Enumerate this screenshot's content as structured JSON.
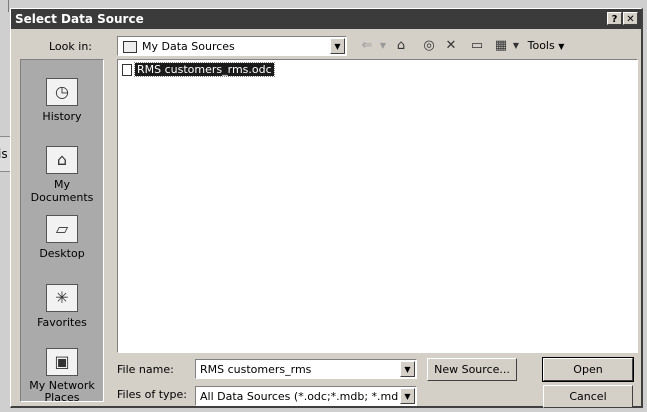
{
  "background": {
    "partial_label": "is"
  },
  "dialog": {
    "title": "Select Data Source",
    "help_glyph": "?",
    "close_glyph": "✕"
  },
  "look_in": {
    "label": "Look in:",
    "value": "My Data Sources"
  },
  "toolbar": {
    "back_glyph": "⇐",
    "up_glyph": "⌂",
    "search_glyph": "◎",
    "delete_glyph": "✕",
    "new_folder_glyph": "▭",
    "views_glyph": "▦",
    "tools_label": "Tools"
  },
  "places": [
    {
      "label": "History",
      "icon": "history-icon",
      "glyph": "◷"
    },
    {
      "label": "My Documents",
      "icon": "my-documents-icon",
      "glyph": "⌂"
    },
    {
      "label": "Desktop",
      "icon": "desktop-icon",
      "glyph": "▱"
    },
    {
      "label": "Favorites",
      "icon": "favorites-icon",
      "glyph": "✳"
    },
    {
      "label": "My Network Places",
      "icon": "network-places-icon",
      "glyph": "▣"
    }
  ],
  "files": [
    {
      "name": "RMS customers_rms.odc"
    }
  ],
  "file_name": {
    "label": "File name:",
    "value": "RMS customers_rms"
  },
  "files_of_type": {
    "label": "Files of type:",
    "value": "All Data Sources (*.odc;*.mdb; *.mde;*"
  },
  "buttons": {
    "new_source": "New Source...",
    "open": "Open",
    "cancel": "Cancel"
  }
}
